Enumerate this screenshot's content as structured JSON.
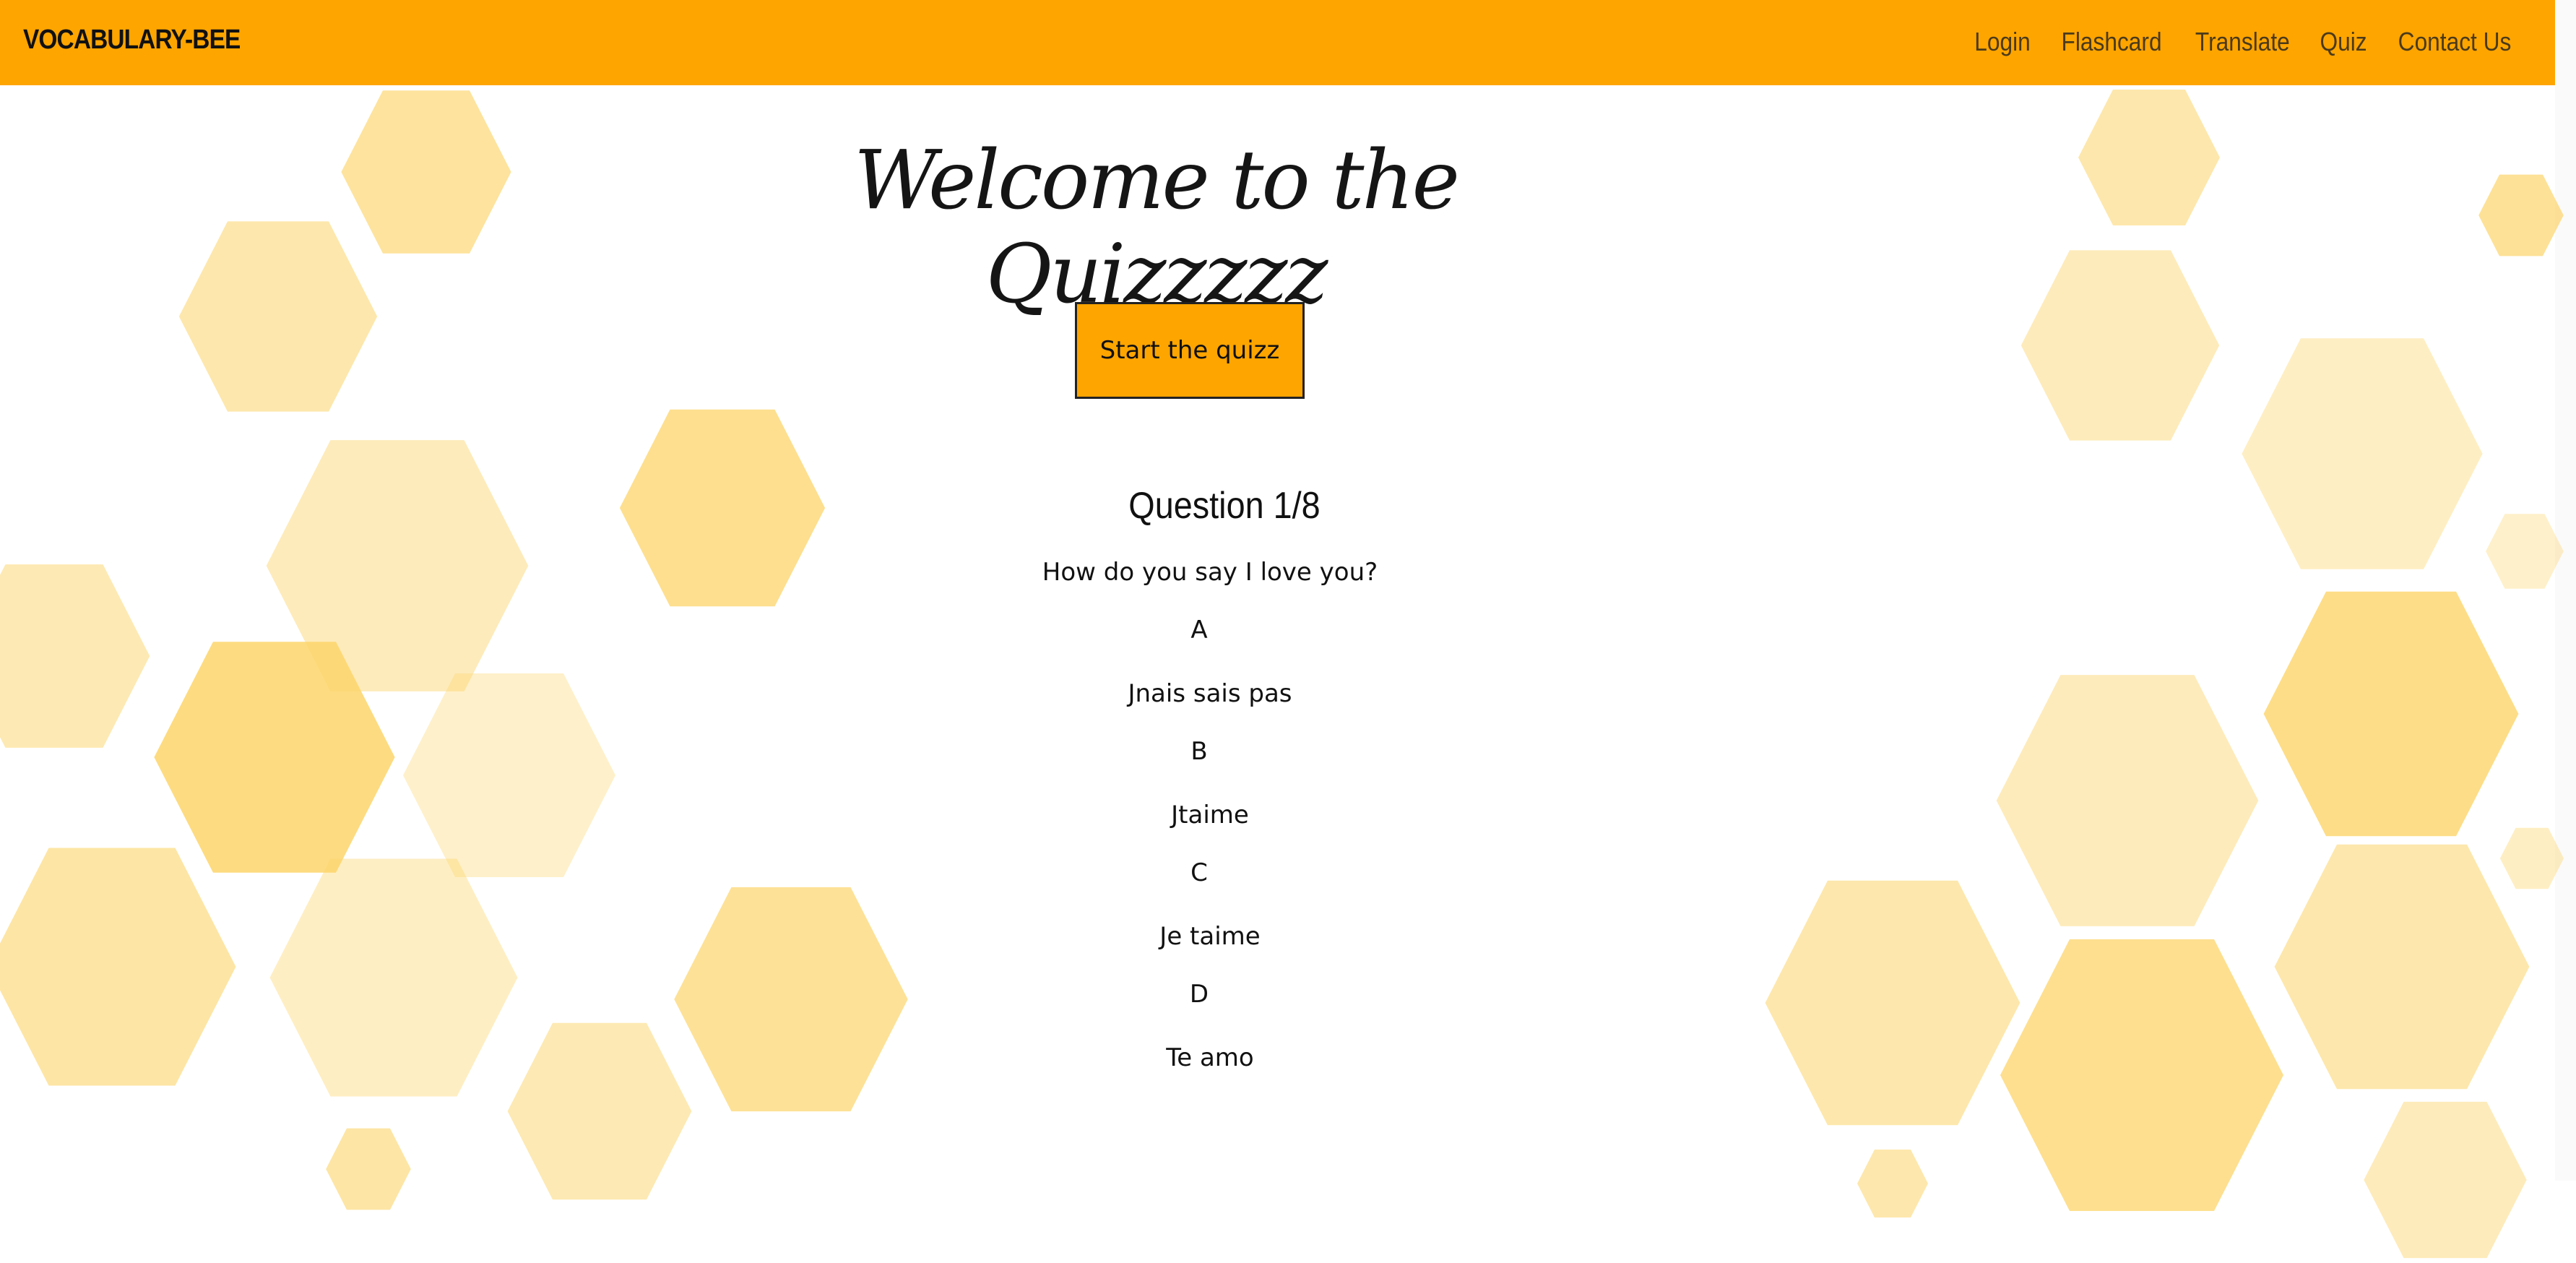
{
  "nav": {
    "brand": "VOCABULARY-BEE",
    "links": [
      "Login",
      "Flashcard",
      "Translate",
      "Quiz",
      "Contact Us"
    ]
  },
  "main": {
    "title": "Welcome to the Quizzzzz",
    "start_button": "Start the quizz",
    "question_number": "Question 1/8",
    "question": "How do you say I love you?",
    "options": [
      {
        "letter": "A",
        "text": "Jnais sais pas"
      },
      {
        "letter": "B",
        "text": "Jtaime"
      },
      {
        "letter": "C",
        "text": "Je taime"
      },
      {
        "letter": "D",
        "text": "Te amo"
      }
    ]
  },
  "colors": {
    "accent": "#FFA500",
    "honeycomb": "#FDD56A"
  }
}
